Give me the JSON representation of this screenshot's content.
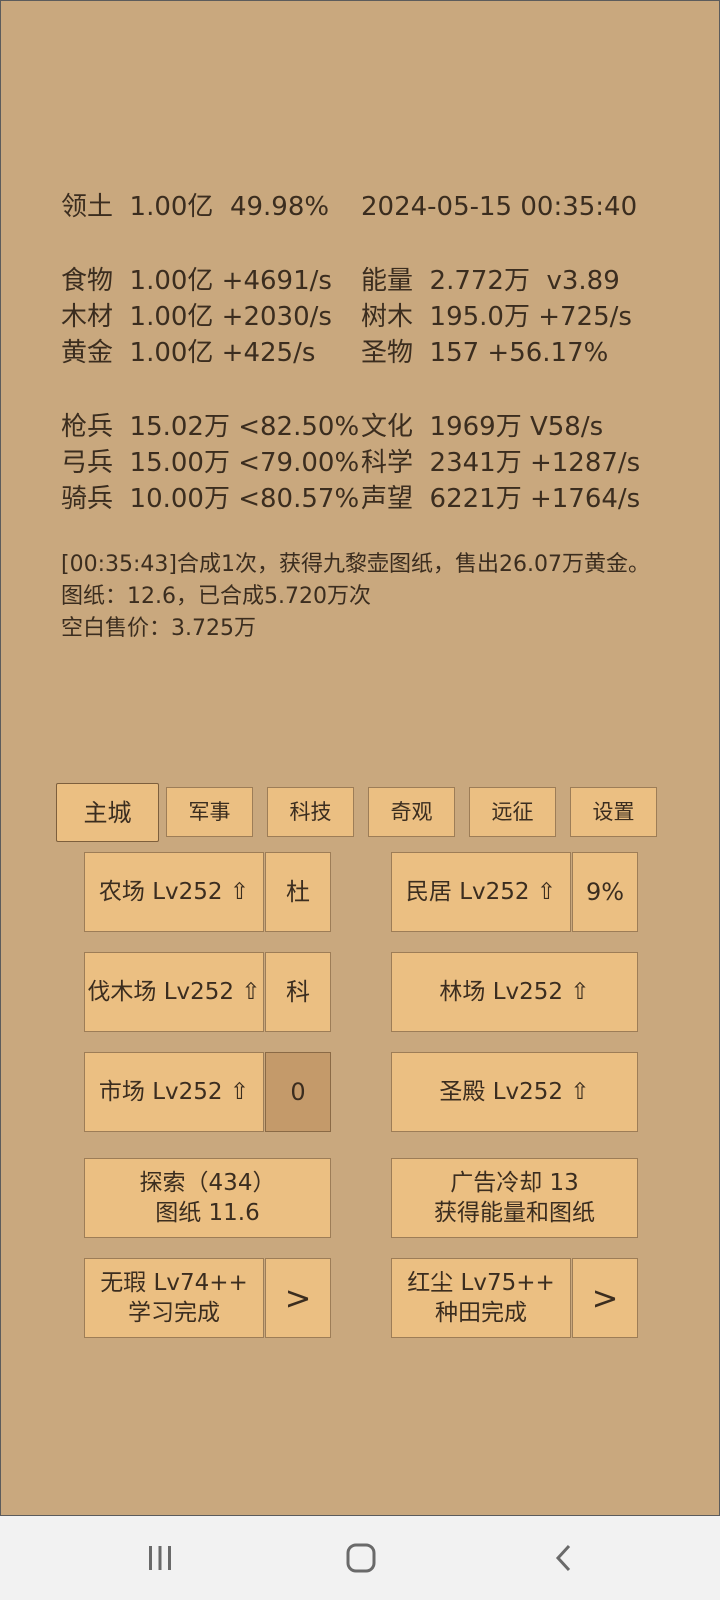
{
  "stats": {
    "territory": "领土  1.00亿  49.98%",
    "datetime": "2024-05-15 00:35:40",
    "food": "食物  1.00亿 +4691/s",
    "energy": "能量  2.772万  v3.89",
    "wood": "木材  1.00亿 +2030/s",
    "tree": "树木  195.0万 +725/s",
    "gold": "黄金  1.00亿 +425/s",
    "relic": "圣物  157 +56.17%",
    "spearman": "枪兵  15.02万 <82.50%",
    "culture": "文化  1969万 V58/s",
    "archer": "弓兵  15.00万 <79.00%",
    "science": "科学  2341万 +1287/s",
    "cavalry": "骑兵  10.00万 <80.57%",
    "prestige": "声望  6221万 +1764/s"
  },
  "log": {
    "line1": "[00:35:43]合成1次，获得九黎壶图纸，售出26.07万黄金。",
    "line2": "图纸：12.6，已合成5.720万次",
    "line3": "空白售价：3.725万"
  },
  "tabs": [
    {
      "label": "主城",
      "active": true
    },
    {
      "label": "军事"
    },
    {
      "label": "科技"
    },
    {
      "label": "奇观"
    },
    {
      "label": "远征"
    },
    {
      "label": "设置"
    }
  ],
  "buildings": {
    "farm": "农场 Lv252 ⇧",
    "farm_side": "杜",
    "residence": "民居 Lv252 ⇧",
    "residence_side": "9%",
    "lumber": "伐木场 Lv252 ⇧",
    "lumber_side": "科",
    "forest": "林场 Lv252 ⇧",
    "market": "市场 Lv252 ⇧",
    "market_side": "0",
    "temple": "圣殿 Lv252 ⇧"
  },
  "actions": {
    "explore_line1": "探索（434）",
    "explore_line2": "图纸 11.6",
    "ad_line1": "广告冷却 13",
    "ad_line2": "获得能量和图纸",
    "flawless_line1": "无瑕 Lv74++",
    "flawless_line2": "学习完成",
    "flawless_more": ">",
    "dust_line1": "红尘 Lv75++",
    "dust_line2": "种田完成",
    "dust_more": ">"
  },
  "colors": {
    "background": "#c9a87e",
    "button": "#ebbf82",
    "button_pressed": "#c49a6a",
    "text": "#3b2d1f"
  },
  "icons": {
    "nav_recent": "recent-apps-icon",
    "nav_home": "home-icon",
    "nav_back": "back-icon"
  }
}
